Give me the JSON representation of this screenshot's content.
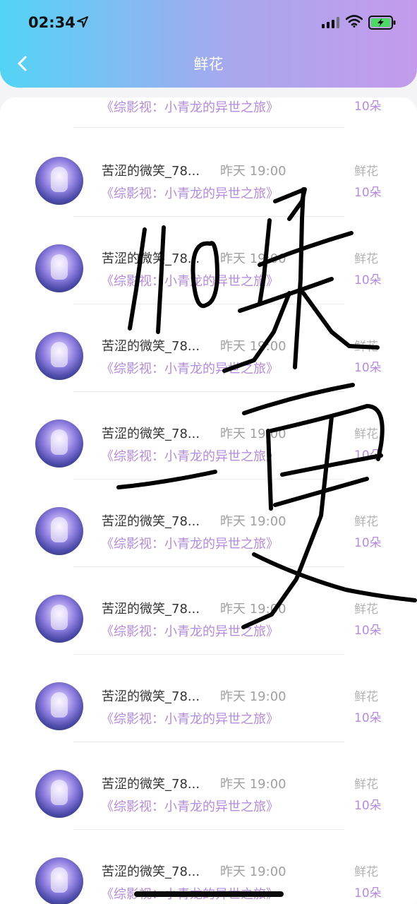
{
  "status_bar": {
    "time": "02:34"
  },
  "header": {
    "title": "鲜花"
  },
  "list": [
    {
      "name": "",
      "time": "",
      "book": "《综影视：小青龙的异世之旅》",
      "gift_label": "",
      "gift_count": "10朵"
    },
    {
      "name": "苦涩的微笑_78...",
      "time": "昨天 19:00",
      "book": "《综影视：小青龙的异世之旅》",
      "gift_label": "鲜花",
      "gift_count": "10朵"
    },
    {
      "name": "苦涩的微笑_78...",
      "time": "昨天 19:00",
      "book": "《综影视：小青龙的异世之旅》",
      "gift_label": "鲜花",
      "gift_count": "10朵"
    },
    {
      "name": "苦涩的微笑_78...",
      "time": "昨天 19:00",
      "book": "《综影视：小青龙的异世之旅》",
      "gift_label": "鲜花",
      "gift_count": "10朵"
    },
    {
      "name": "苦涩的微笑_78...",
      "time": "昨天 19:00",
      "book": "《综影视：小青龙的异世之旅》",
      "gift_label": "鲜花",
      "gift_count": "10朵"
    },
    {
      "name": "苦涩的微笑_78...",
      "time": "昨天 19:00",
      "book": "《综影视：小青龙的异世之旅》",
      "gift_label": "鲜花",
      "gift_count": "10朵"
    },
    {
      "name": "苦涩的微笑_78...",
      "time": "昨天 19:00",
      "book": "《综影视：小青龙的异世之旅》",
      "gift_label": "鲜花",
      "gift_count": "10朵"
    },
    {
      "name": "苦涩的微笑_78...",
      "time": "昨天 19:00",
      "book": "《综影视：小青龙的异世之旅》",
      "gift_label": "鲜花",
      "gift_count": "10朵"
    },
    {
      "name": "苦涩的微笑_78...",
      "time": "昨天 19:00",
      "book": "《综影视：小青龙的异世之旅》",
      "gift_label": "鲜花",
      "gift_count": "10朵"
    },
    {
      "name": "苦涩的微笑_78...",
      "time": "昨天 19:00",
      "book": "《综影视：小青龙的异世之旅》",
      "gift_label": "鲜花",
      "gift_count": "10朵"
    }
  ],
  "icons": {
    "back": "back-arrow-icon",
    "location": "location-arrow-icon",
    "signal": "cellular-signal-icon",
    "wifi": "wifi-icon",
    "battery": "battery-charging-icon"
  },
  "colors": {
    "header_start": "#52d4f5",
    "header_end": "#c49bec",
    "accent": "#b58ae0"
  }
}
